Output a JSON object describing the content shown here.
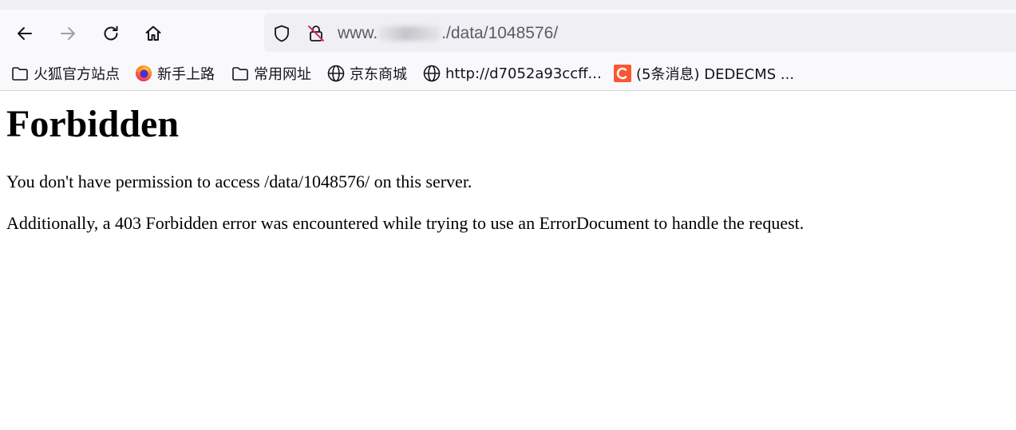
{
  "browser": {
    "url": {
      "host_start": "www.",
      "host_end": ".",
      "path": "/data/1048576/"
    },
    "nav": {
      "back_icon": "back-arrow-icon",
      "forward_icon": "forward-arrow-icon",
      "reload_icon": "reload-icon",
      "home_icon": "home-icon"
    },
    "bookmarks": [
      {
        "label": "火狐官方站点",
        "icon": "folder-icon"
      },
      {
        "label": "新手上路",
        "icon": "firefox-icon"
      },
      {
        "label": "常用网址",
        "icon": "folder-icon"
      },
      {
        "label": "京东商城",
        "icon": "globe-icon"
      },
      {
        "label": "http://d7052a93ccff...",
        "icon": "globe-icon"
      },
      {
        "label": "(5条消息) DEDECMS ...",
        "icon": "csdn-icon"
      }
    ],
    "colors": {
      "csdn_orange": "#fc5531",
      "toolbar_bg": "#f9f9fb",
      "urlbar_bg": "#f0f0f4",
      "insecure_red": "#e22850"
    }
  },
  "page": {
    "heading": "Forbidden",
    "message": "You don't have permission to access /data/1048576/ on this server.",
    "additional": "Additionally, a 403 Forbidden error was encountered while trying to use an ErrorDocument to handle the request."
  }
}
